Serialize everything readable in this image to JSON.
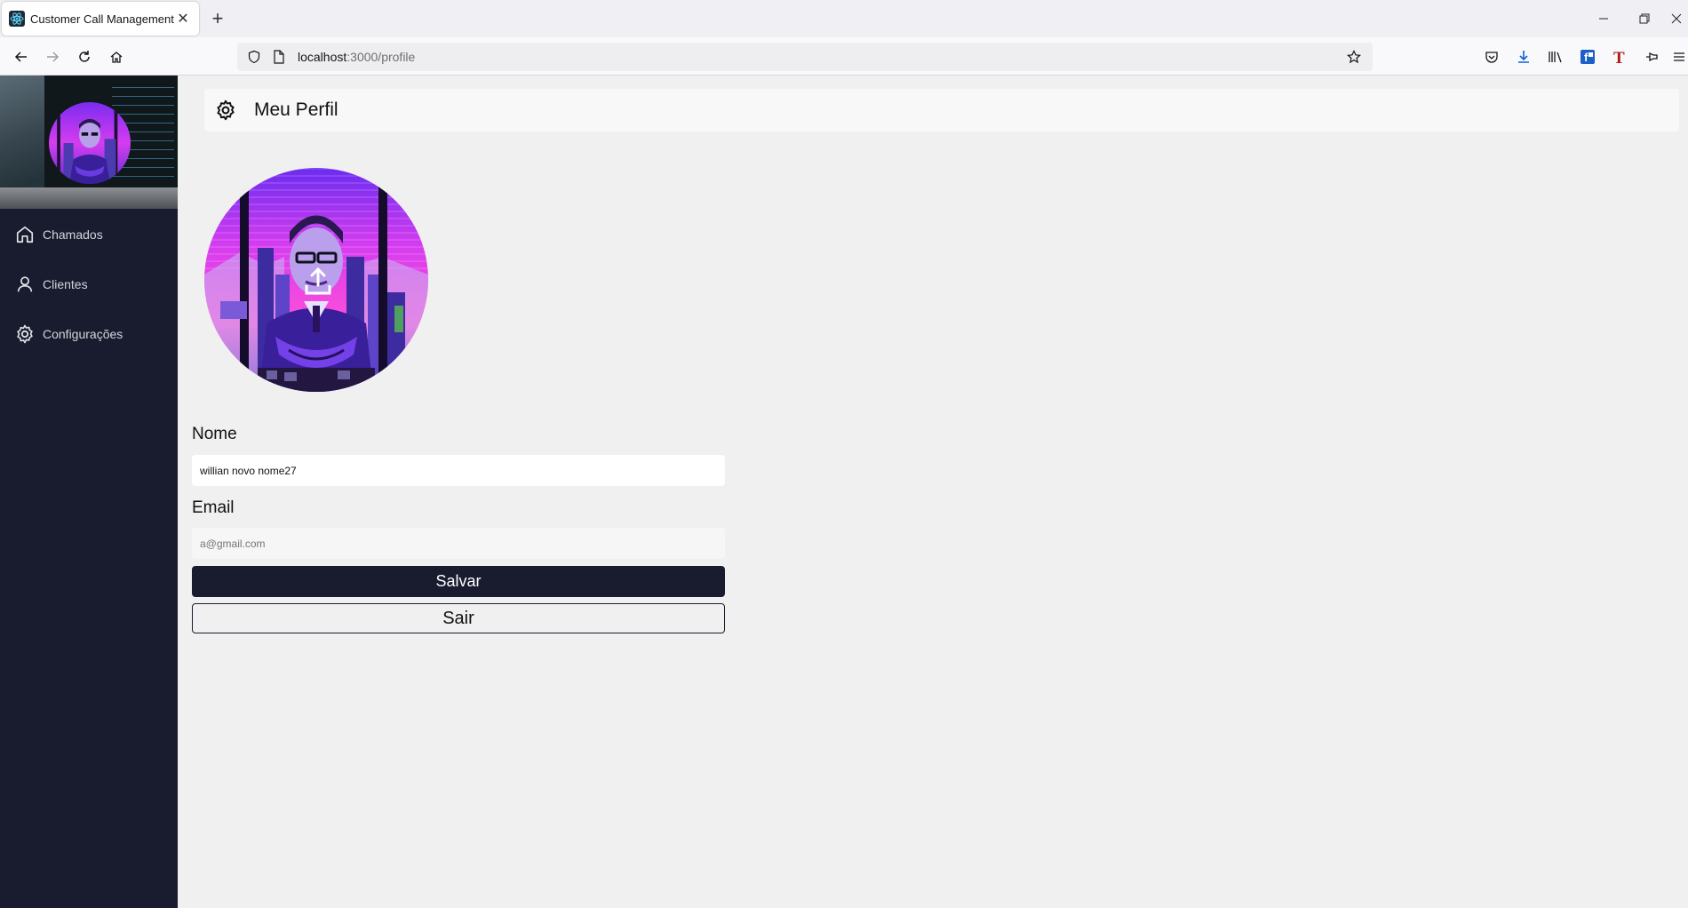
{
  "browser": {
    "tab_title": "Customer Call Management",
    "url_host": "localhost",
    "url_path": ":3000/profile",
    "icons": [
      "back-icon",
      "forward-icon",
      "reload-icon",
      "home-icon",
      "shield-icon",
      "page-icon",
      "bookmark-star-icon",
      "pocket-icon",
      "download-icon",
      "library-icon",
      "extension-f-icon",
      "extension-t-icon",
      "pin-icon",
      "menu-icon"
    ]
  },
  "sidebar": {
    "items": [
      {
        "label": "Chamados",
        "icon": "home-icon"
      },
      {
        "label": "Clientes",
        "icon": "user-icon"
      },
      {
        "label": "Configurações",
        "icon": "gear-icon"
      }
    ]
  },
  "header": {
    "title": "Meu Perfil",
    "icon": "gear-icon"
  },
  "profile": {
    "avatar_icon": "upload-icon",
    "name_label": "Nome",
    "name_value": "willian novo nome27",
    "email_label": "Email",
    "email_placeholder": "a@gmail.com",
    "save_label": "Salvar",
    "logout_label": "Sair"
  },
  "colors": {
    "sidebar_bg": "#181c2e",
    "page_bg": "#f0f0f0",
    "button_bg": "#181c2e",
    "avatar_accent": "#d63cf0"
  }
}
